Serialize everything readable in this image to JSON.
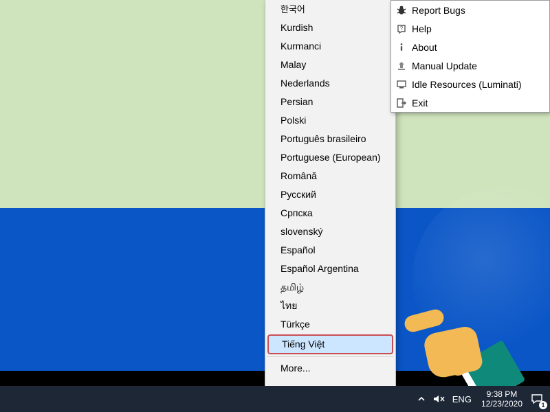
{
  "languages": [
    {
      "label": "한국어"
    },
    {
      "label": "Kurdish"
    },
    {
      "label": "Kurmanci"
    },
    {
      "label": "Malay"
    },
    {
      "label": "Nederlands"
    },
    {
      "label": "Persian"
    },
    {
      "label": "Polski"
    },
    {
      "label": "Português brasileiro"
    },
    {
      "label": "Portuguese (European)"
    },
    {
      "label": "Română"
    },
    {
      "label": "Русский"
    },
    {
      "label": "Српска"
    },
    {
      "label": "slovenský"
    },
    {
      "label": "Español"
    },
    {
      "label": "Español Argentina"
    },
    {
      "label": "தமிழ்"
    },
    {
      "label": "ไทย"
    },
    {
      "label": "Türkçe"
    },
    {
      "label": "Tiếng Việt",
      "highlight": true
    }
  ],
  "languages_more": "More...",
  "tray_menu": [
    {
      "icon": "bug",
      "label": "Report Bugs"
    },
    {
      "icon": "help",
      "label": "Help"
    },
    {
      "icon": "about",
      "label": "About"
    },
    {
      "icon": "update",
      "label": "Manual Update"
    },
    {
      "icon": "idle",
      "label": "Idle Resources (Luminati)"
    },
    {
      "icon": "exit",
      "label": "Exit"
    }
  ],
  "taskbar": {
    "lang": "ENG",
    "time": "9:38 PM",
    "date": "12/23/2020",
    "notif_count": "1"
  }
}
